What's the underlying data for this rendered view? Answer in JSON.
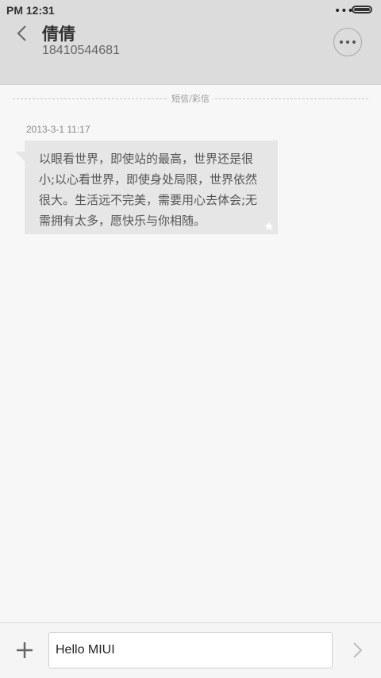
{
  "status_bar": {
    "time": "PM 12:31",
    "dots": "•••"
  },
  "header": {
    "contact_name": "倩倩",
    "contact_number": "18410544681"
  },
  "conversation": {
    "type_label": "短信/彩信",
    "messages": [
      {
        "timestamp": "2013-3-1 11:17",
        "text": "以眼看世界，即使站的最高，世界还是很小;以心看世界，即使身处局限，世界依然很大。生活远不完美，需要用心去体会;无需拥有太多，愿快乐与你相随。",
        "starred": true
      }
    ]
  },
  "composer": {
    "input_value": "Hello MIUI"
  },
  "icons": {
    "back": "chevron-left-icon",
    "more": "more-options-icon",
    "star": "star-icon",
    "add": "plus-icon",
    "send": "chevron-right-icon"
  },
  "colors": {
    "header_bg": "#dcdcdc",
    "bubble_bg": "#e6e6e6",
    "page_bg": "#f7f7f7"
  }
}
